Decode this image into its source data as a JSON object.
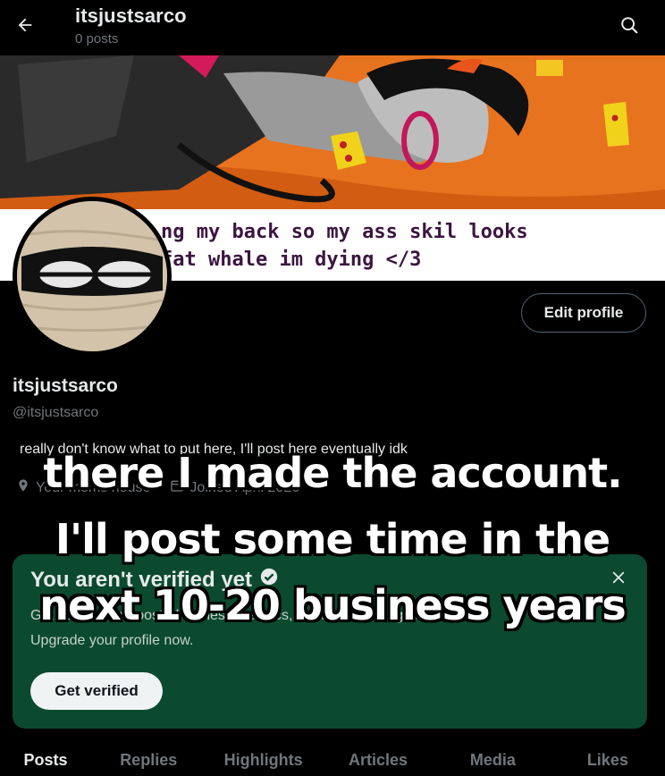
{
  "header": {
    "title": "itsjustsarco",
    "post_count": "0 posts"
  },
  "banner": {
    "caption_line1": "ng my back so my ass skil looks",
    "caption_line2": "fat whale im dying </3"
  },
  "profile": {
    "edit_label": "Edit profile",
    "display_name": "itsjustsarco",
    "handle": "@itsjustsarco",
    "bio": "really don't know what to put here, I'll post here eventually idk",
    "location": "Your moms house",
    "joined": "Joined April 2026"
  },
  "verify_card": {
    "title": "You aren't verified yet",
    "description": "Get verified for boosted replies, analytics, ad-free browsing, and more.",
    "subtext": "Upgrade your profile now.",
    "button_label": "Get verified",
    "bg_color": "#0b4a2f"
  },
  "tabs": [
    {
      "label": "Posts",
      "active": true
    },
    {
      "label": "Replies",
      "active": false
    },
    {
      "label": "Highlights",
      "active": false
    },
    {
      "label": "Articles",
      "active": false
    },
    {
      "label": "Media",
      "active": false
    },
    {
      "label": "Likes",
      "active": false
    }
  ],
  "overlay_caption": {
    "line1": "there I made the account.",
    "line2": "I'll post some time in the",
    "line3": "next 10-20 business years"
  },
  "icons": {
    "back": "arrow-left-icon",
    "search": "search-icon",
    "close": "close-icon",
    "verified": "verified-badge-icon",
    "location": "location-icon",
    "calendar": "calendar-icon"
  }
}
